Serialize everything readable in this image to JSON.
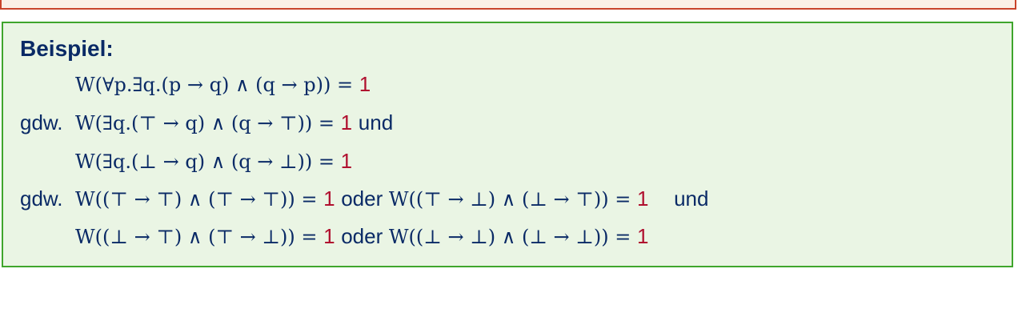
{
  "heading": "Beispiel:",
  "prefix": "gdw.",
  "connective_and": "und",
  "connective_or": "oder",
  "value_one": "1",
  "colors": {
    "text": "#0a2a66",
    "value": "#b0102f",
    "example_border": "#3fa52c",
    "example_fill": "#eaf5e4",
    "top_border": "#c9432b"
  },
  "lines": {
    "l1": "W(∀p.∃q.(p → q) ∧ (q → p)) =",
    "l2": "W(∃q.(⊤ → q) ∧ (q → ⊤)) =",
    "l3": "W(∃q.(⊥ → q) ∧ (q → ⊥)) =",
    "l4a": "W((⊤ → ⊤) ∧ (⊤ → ⊤)) =",
    "l4b": "W((⊤ → ⊥) ∧ (⊥ → ⊤)) =",
    "l5a": "W((⊥ → ⊤) ∧ (⊤ → ⊥)) =",
    "l5b": "W((⊥ → ⊥) ∧ (⊥ → ⊥)) ="
  }
}
